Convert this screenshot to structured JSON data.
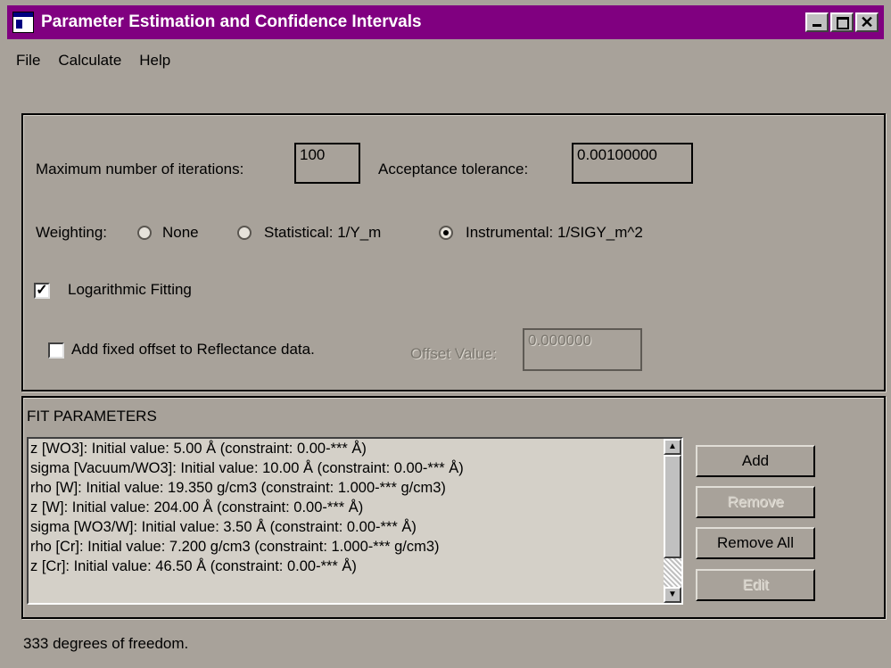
{
  "window": {
    "title": "Parameter Estimation and Confidence Intervals",
    "controls": {
      "minimize_icon": "minimize-icon",
      "maximize_icon": "maximize-icon",
      "close_label": "✕"
    }
  },
  "menu": [
    "File",
    "Calculate",
    "Help"
  ],
  "settings": {
    "max_iterations_label": "Maximum number of iterations:",
    "max_iterations_value": "100",
    "tolerance_label": "Acceptance tolerance:",
    "tolerance_value": "0.00100000",
    "weighting_label": "Weighting:",
    "weighting_options": [
      "None",
      "Statistical: 1/Y_m",
      "Instrumental: 1/SIGY_m^2"
    ],
    "weighting_selected": "Instrumental: 1/SIGY_m^2",
    "log_fitting_label": "Logarithmic Fitting",
    "log_fitting_checked": true,
    "offset_label": "Add fixed offset to Reflectance data.",
    "offset_checked": false,
    "offset_value_label": "Offset Value:",
    "offset_value": "0.000000"
  },
  "fit_parameters": {
    "title": "FIT PARAMETERS",
    "items": [
      "z [WO3]: Initial value: 5.00 Å (constraint: 0.00-*** Å)",
      "sigma [Vacuum/WO3]: Initial value: 10.00 Å (constraint: 0.00-*** Å)",
      "rho [W]: Initial value: 19.350 g/cm3 (constraint: 1.000-*** g/cm3)",
      "z [W]: Initial value: 204.00 Å (constraint: 0.00-*** Å)",
      "sigma [WO3/W]: Initial value: 3.50 Å (constraint: 0.00-*** Å)",
      "rho [Cr]: Initial value: 7.200 g/cm3 (constraint: 1.000-*** g/cm3)",
      "z [Cr]: Initial value: 46.50 Å (constraint: 0.00-*** Å)"
    ],
    "buttons": {
      "add": "Add",
      "remove": "Remove",
      "remove_all": "Remove All",
      "edit": "Edit"
    }
  },
  "status": "333 degrees of freedom."
}
